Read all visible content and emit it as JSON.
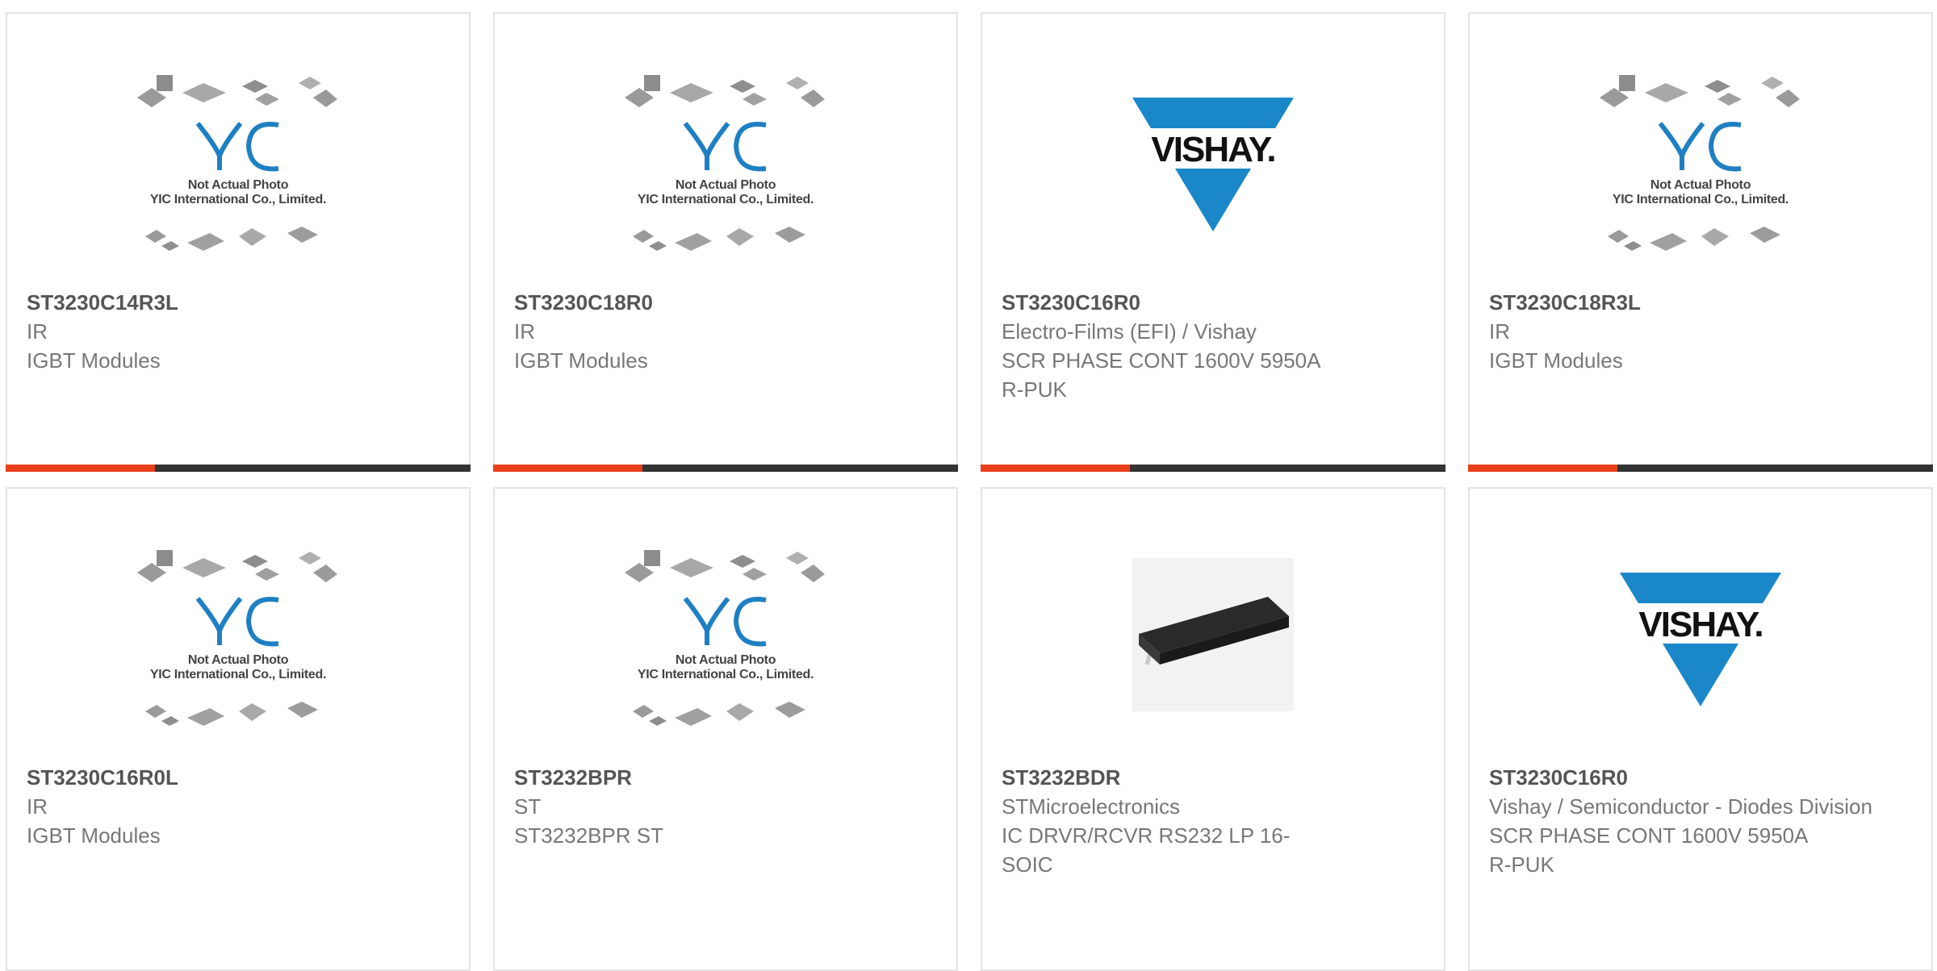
{
  "placeholder": {
    "line1": "Not Actual Photo",
    "line2": "YIC International Co., Limited.",
    "logo_text": "YIC"
  },
  "vishay_logo_text": "VISHAY.",
  "accent_color": "#e8401c",
  "bar_color": "#333333",
  "products": [
    {
      "part": "ST3230C14R3L",
      "manufacturer": "IR",
      "description": "IGBT Modules",
      "image": "yic-placeholder"
    },
    {
      "part": "ST3230C18R0",
      "manufacturer": "IR",
      "description": "IGBT Modules",
      "image": "yic-placeholder"
    },
    {
      "part": "ST3230C16R0",
      "manufacturer": "Electro-Films (EFI) / Vishay",
      "description": "SCR PHASE CONT 1600V 5950A R-PUK",
      "image": "vishay-logo"
    },
    {
      "part": "ST3230C18R3L",
      "manufacturer": "IR",
      "description": "IGBT Modules",
      "image": "yic-placeholder"
    },
    {
      "part": "ST3230C16R0L",
      "manufacturer": "IR",
      "description": "IGBT Modules",
      "image": "yic-placeholder"
    },
    {
      "part": "ST3232BPR",
      "manufacturer": "ST",
      "description": "ST3232BPR ST",
      "image": "yic-placeholder"
    },
    {
      "part": "ST3232BDR",
      "manufacturer": "STMicroelectronics",
      "description": "IC DRVR/RCVR RS232 LP 16-SOIC",
      "image": "soic-chip"
    },
    {
      "part": "ST3230C16R0",
      "manufacturer": "Vishay / Semiconductor - Diodes Division",
      "description": "SCR PHASE CONT 1600V 5950A R-PUK",
      "image": "vishay-logo"
    }
  ]
}
